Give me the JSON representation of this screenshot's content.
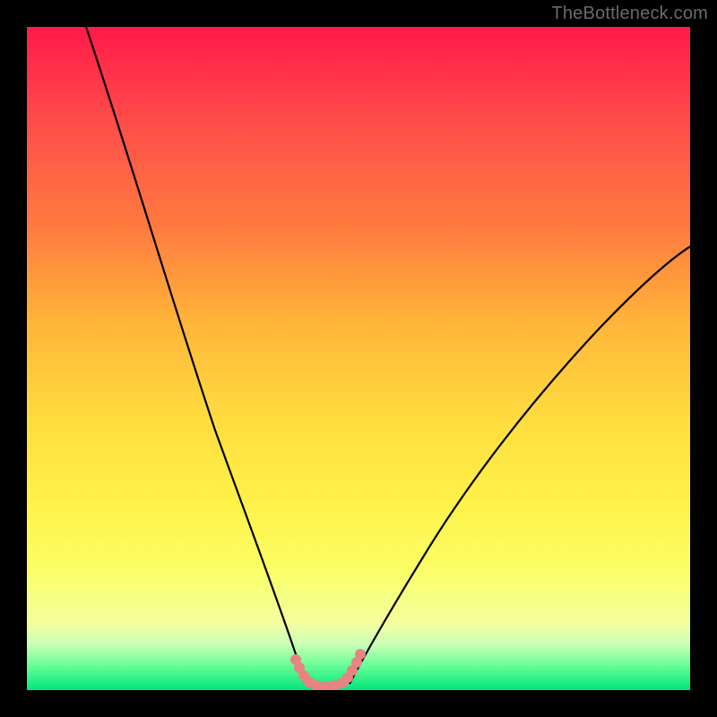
{
  "watermark": "TheBottleneck.com",
  "chart_data": {
    "type": "line",
    "title": "",
    "xlabel": "",
    "ylabel": "",
    "xlim": [
      0,
      100
    ],
    "ylim": [
      0,
      100
    ],
    "grid": false,
    "series": [
      {
        "name": "left-curve",
        "x": [
          9,
          12,
          15,
          18,
          21,
          24,
          27,
          30,
          33,
          36,
          37.5,
          39,
          40,
          41,
          41.8
        ],
        "values": [
          100,
          88,
          76,
          65,
          55,
          46,
          37,
          29,
          22,
          15,
          11,
          7,
          4,
          2,
          1
        ]
      },
      {
        "name": "right-curve",
        "x": [
          48.5,
          50,
          52,
          55,
          58,
          62,
          66,
          71,
          76,
          82,
          88,
          94,
          100
        ],
        "values": [
          1,
          2,
          4,
          7,
          11,
          16,
          22,
          29,
          36,
          44,
          52,
          60,
          67
        ]
      },
      {
        "name": "bottom-dotted",
        "x": [
          41,
          41.8,
          42.5,
          43.3,
          44.1,
          45,
          46,
          47,
          48,
          48.5,
          49.2,
          49.7
        ],
        "values": [
          3,
          2,
          1.3,
          1,
          0.8,
          0.7,
          0.7,
          0.8,
          1,
          1.4,
          2,
          3
        ]
      }
    ],
    "colors": {
      "curve_stroke": "#000000",
      "dot_fill": "#e98383",
      "background_top": "#ff1a4a",
      "background_bottom": "#00e67a"
    }
  }
}
